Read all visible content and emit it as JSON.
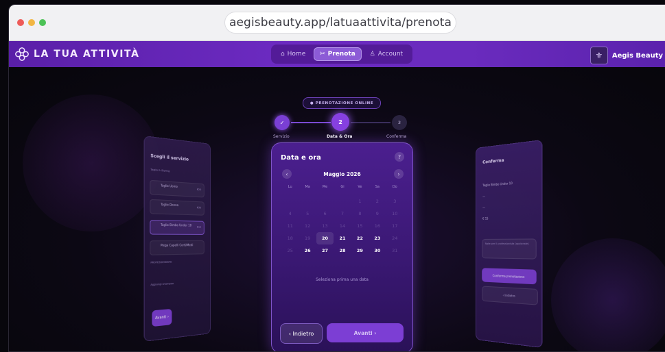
{
  "browser": {
    "url": "aegisbeauty.app/latuaattivita/prenota"
  },
  "app": {
    "brand": "LA TUA ATTIVITÀ",
    "nav": [
      {
        "label": "Home",
        "icon": "home-icon"
      },
      {
        "label": "Prenota",
        "icon": "scissors-icon"
      },
      {
        "label": "Account",
        "icon": "user-icon"
      }
    ],
    "account_name": "Aegis Beauty"
  },
  "wizard": {
    "badge": "● PRENOTAZIONE ONLINE",
    "steps": [
      {
        "num": "✓",
        "label": "Servizio"
      },
      {
        "num": "2",
        "label": "Data & Ora"
      },
      {
        "num": "3",
        "label": "Conferma"
      }
    ]
  },
  "calendar": {
    "title": "Data e ora",
    "help": "?",
    "prev": "‹",
    "next": "›",
    "month": "Maggio 2026",
    "weekdays": [
      "Lu",
      "Ma",
      "Me",
      "Gi",
      "Ve",
      "Sa",
      "Do"
    ],
    "days": [
      {
        "d": "",
        "s": "empty"
      },
      {
        "d": "",
        "s": "empty"
      },
      {
        "d": "",
        "s": "empty"
      },
      {
        "d": "",
        "s": "empty"
      },
      {
        "d": "1",
        "s": "off"
      },
      {
        "d": "2",
        "s": "off"
      },
      {
        "d": "3",
        "s": "off"
      },
      {
        "d": "4",
        "s": "off"
      },
      {
        "d": "5",
        "s": "off"
      },
      {
        "d": "6",
        "s": "off"
      },
      {
        "d": "7",
        "s": "off"
      },
      {
        "d": "8",
        "s": "off"
      },
      {
        "d": "9",
        "s": "off"
      },
      {
        "d": "10",
        "s": "off"
      },
      {
        "d": "11",
        "s": "off"
      },
      {
        "d": "12",
        "s": "off"
      },
      {
        "d": "13",
        "s": "off"
      },
      {
        "d": "14",
        "s": "off"
      },
      {
        "d": "15",
        "s": "off"
      },
      {
        "d": "16",
        "s": "off"
      },
      {
        "d": "17",
        "s": "off"
      },
      {
        "d": "18",
        "s": "off"
      },
      {
        "d": "19",
        "s": "off"
      },
      {
        "d": "20",
        "s": "today"
      },
      {
        "d": "21",
        "s": "avail"
      },
      {
        "d": "22",
        "s": "avail"
      },
      {
        "d": "23",
        "s": "avail"
      },
      {
        "d": "24",
        "s": "off"
      },
      {
        "d": "25",
        "s": "off"
      },
      {
        "d": "26",
        "s": "avail"
      },
      {
        "d": "27",
        "s": "avail"
      },
      {
        "d": "28",
        "s": "avail"
      },
      {
        "d": "29",
        "s": "avail"
      },
      {
        "d": "30",
        "s": "avail"
      },
      {
        "d": "31",
        "s": "off"
      }
    ],
    "note": "Seleziona prima una data",
    "back_label": "‹  Indietro",
    "next_label": "Avanti  ›"
  },
  "left_card": {
    "title": "Scegli il servizio",
    "category": "Taglio & Styling",
    "items": [
      {
        "label": "Taglio Uomo",
        "price": "€20"
      },
      {
        "label": "Taglio Donna",
        "price": "€35"
      },
      {
        "label": "Taglio Bimbo Under 10",
        "price": "€15"
      },
      {
        "label": "Piega Capelli Corti/Medi",
        "price": ""
      }
    ],
    "section_label": "PROFESSIONISTA",
    "extra_label": "Aggiungi shampoo",
    "button": "Avanti ›"
  },
  "right_card": {
    "title": "Conferma",
    "rows": [
      "Taglio Bimbo Under 10",
      "—",
      "—",
      "€ 15"
    ],
    "field_placeholder": "Note per il professionista (opzionale)",
    "confirm": "Conferma prenotazione",
    "cancel": "‹ Indietro"
  }
}
